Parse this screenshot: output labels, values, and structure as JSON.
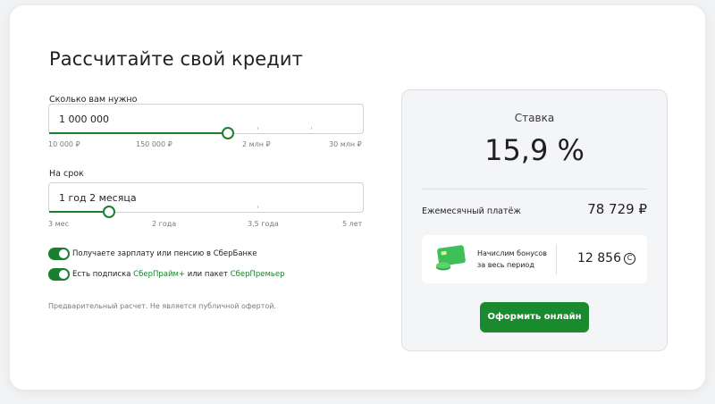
{
  "title": "Рассчитайте свой кредит",
  "amount": {
    "label": "Сколько вам нужно",
    "value": "1 000 000",
    "slider_fraction": 0.57,
    "scale": [
      "10 000 ₽",
      "150 000 ₽",
      "2 млн ₽",
      "30 млн ₽"
    ]
  },
  "term": {
    "label": "На срок",
    "value": "1 год 2 месяца",
    "slider_fraction": 0.19,
    "scale": [
      "3 мес",
      "2 года",
      "3,5 года",
      "5 лет"
    ]
  },
  "toggles": [
    {
      "text": "Получаете зарплату или пенсию в СберБанке",
      "on": true
    },
    {
      "text_before": "Есть подписка ",
      "link1": "СберПрайм+",
      "text_mid": " или пакет ",
      "link2": "СберПремьер",
      "on": true
    }
  ],
  "disclaimer": "Предварительный расчет. Не является публичной офертой.",
  "summary": {
    "rate_label": "Ставка",
    "rate_value": "15,9 %",
    "payment_label": "Ежемесячный платёж",
    "payment_value": "78 729 ₽",
    "bonus_text_line1": "Начислим бонусов",
    "bonus_text_line2": "за весь период",
    "bonus_value": "12 856",
    "bonus_icon_glyph": "С",
    "cta_label": "Оформить онлайн"
  },
  "colors": {
    "accent": "#1a7f2e",
    "button": "#1a8a2f"
  }
}
